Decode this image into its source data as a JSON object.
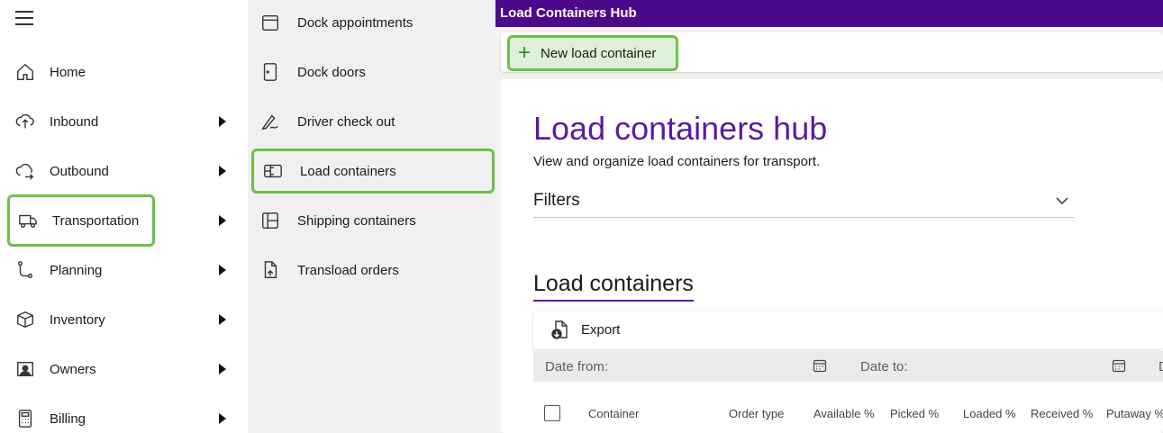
{
  "nav": {
    "items": [
      {
        "label": "Home",
        "icon": "home-icon",
        "has_submenu": false
      },
      {
        "label": "Inbound",
        "icon": "inbound-icon",
        "has_submenu": true
      },
      {
        "label": "Outbound",
        "icon": "outbound-icon",
        "has_submenu": true
      },
      {
        "label": "Transportation",
        "icon": "truck-icon",
        "has_submenu": true,
        "selected": true
      },
      {
        "label": "Planning",
        "icon": "planning-icon",
        "has_submenu": true
      },
      {
        "label": "Inventory",
        "icon": "box-icon",
        "has_submenu": true
      },
      {
        "label": "Owners",
        "icon": "owner-icon",
        "has_submenu": true
      },
      {
        "label": "Billing",
        "icon": "calculator-icon",
        "has_submenu": true
      }
    ]
  },
  "submenu": {
    "items": [
      {
        "label": "Dock appointments",
        "icon": "calendar-icon"
      },
      {
        "label": "Dock doors",
        "icon": "door-icon"
      },
      {
        "label": "Driver check out",
        "icon": "signature-icon"
      },
      {
        "label": "Load containers",
        "icon": "container-icon",
        "selected": true
      },
      {
        "label": "Shipping containers",
        "icon": "shipping-container-icon"
      },
      {
        "label": "Transload orders",
        "icon": "transload-icon"
      }
    ]
  },
  "main": {
    "window_title": "Load Containers Hub",
    "new_button_label": "New load container",
    "hub_title": "Load containers hub",
    "hub_subtitle": "View and organize load containers for transport.",
    "filters_label": "Filters",
    "section_title": "Load containers",
    "export_label": "Export",
    "date_from_label": "Date from:",
    "date_to_label": "Date to:",
    "date_cut_label": "D",
    "columns": [
      "Container",
      "Order type",
      "Available %",
      "Picked %",
      "Loaded %",
      "Received %",
      "Putaway %"
    ]
  },
  "colors": {
    "titlebar": "#4b0a8b",
    "accent": "#5c1aa3",
    "highlight": "#6cc04a"
  }
}
